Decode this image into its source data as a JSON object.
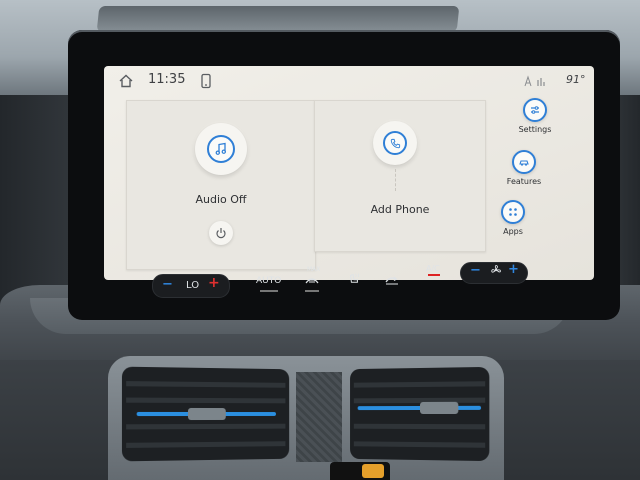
{
  "status_bar": {
    "time": "11:35",
    "outside_temp": "91°"
  },
  "cards": {
    "audio": {
      "label": "Audio Off"
    },
    "phone": {
      "label": "Add Phone"
    }
  },
  "side_menu": [
    {
      "label": "Settings",
      "icon": "settings-sliders-icon"
    },
    {
      "label": "Features",
      "icon": "car-icon"
    },
    {
      "label": "Apps",
      "icon": "grid-icon"
    }
  ],
  "climate": {
    "driver_temp": "LO",
    "auto": "AUTO",
    "max": "MAX",
    "ac": "A/C"
  },
  "colors": {
    "accent": "#2f7fd6",
    "screen_bg": "#ece9e3",
    "temp_up": "#e03030",
    "temp_down": "#2f86e0"
  }
}
